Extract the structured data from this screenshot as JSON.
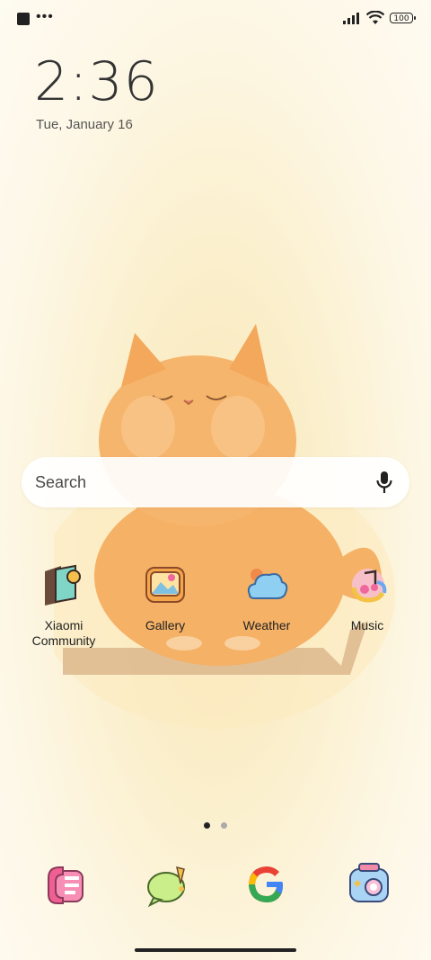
{
  "status": {
    "battery": "100"
  },
  "lockscreen": {
    "time": "2:36",
    "date": "Tue, January 16"
  },
  "search": {
    "placeholder": "Search"
  },
  "apps": [
    {
      "label": "Xiaomi\nCommunity",
      "icon": "xiaomi-community-icon"
    },
    {
      "label": "Gallery",
      "icon": "gallery-icon"
    },
    {
      "label": "Weather",
      "icon": "weather-icon"
    },
    {
      "label": "Music",
      "icon": "music-icon"
    }
  ],
  "dock": [
    {
      "icon": "phone-icon"
    },
    {
      "icon": "messages-icon"
    },
    {
      "icon": "google-icon"
    },
    {
      "icon": "camera-icon"
    }
  ],
  "pager": {
    "pages": 2,
    "current": 1
  }
}
